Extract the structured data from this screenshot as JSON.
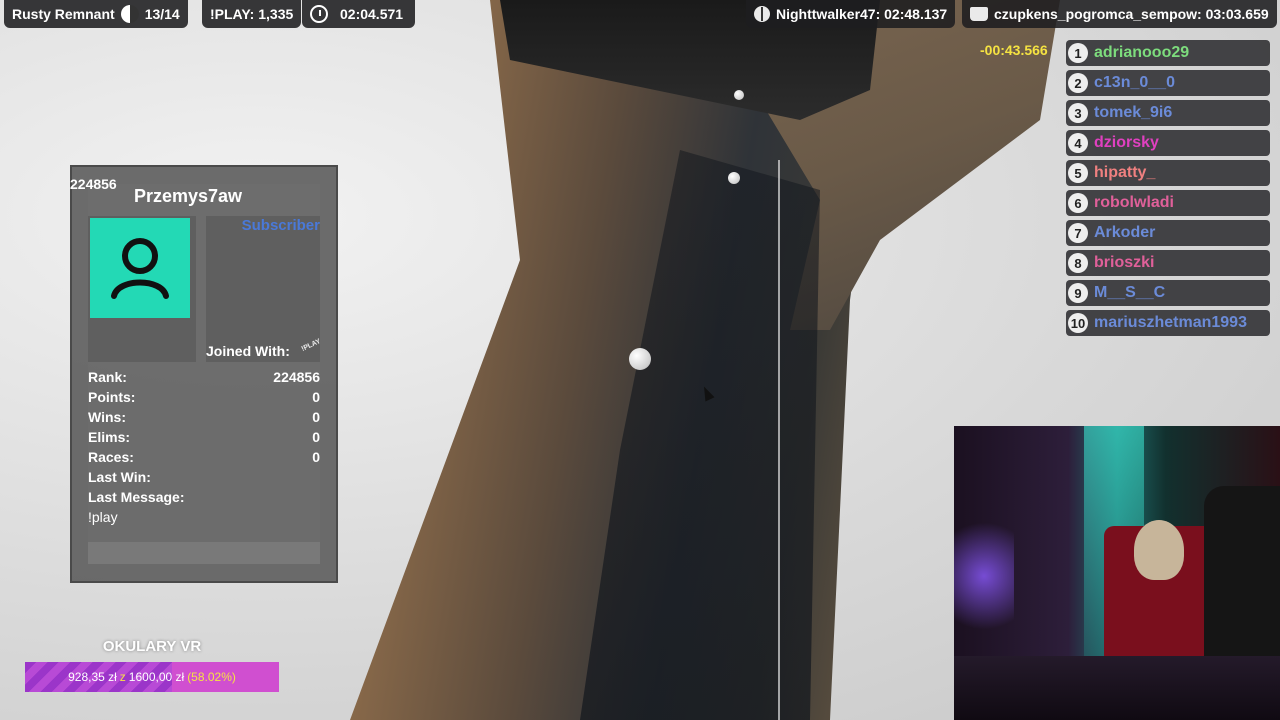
{
  "hud": {
    "map_name": "Rusty Remnant",
    "progress": "13/14",
    "play_count": "!PLAY: 1,335",
    "timer": "02:04.571",
    "record_1": "Nighttwalker47: 02:48.137",
    "record_2": "czupkens_pogromca_sempow: 03:03.659"
  },
  "leaderboard": {
    "delta": "-00:43.566",
    "entries": [
      {
        "rank": "1",
        "name": "adrianooo29",
        "color": "#7ddc7d"
      },
      {
        "rank": "2",
        "name": "c13n_0__0",
        "color": "#6b8bd8"
      },
      {
        "rank": "3",
        "name": "tomek_9i6",
        "color": "#6b8bd8"
      },
      {
        "rank": "4",
        "name": "dziorsky",
        "color": "#e040c0"
      },
      {
        "rank": "5",
        "name": "hipatty_",
        "color": "#f08080"
      },
      {
        "rank": "6",
        "name": "robolwladi",
        "color": "#e0609a"
      },
      {
        "rank": "7",
        "name": "Arkoder",
        "color": "#6b8bd8"
      },
      {
        "rank": "8",
        "name": "brioszki",
        "color": "#e0609a"
      },
      {
        "rank": "9",
        "name": "M__S__C",
        "color": "#6b8bd8"
      },
      {
        "rank": "10",
        "name": "mariuszhetman1993",
        "color": "#6b8bd8"
      }
    ]
  },
  "player_card": {
    "id": "224856",
    "name": "Przemys7aw",
    "badge": "Subscriber",
    "joined_with": "Joined With:",
    "joined_badge": "!PLAY",
    "stats": [
      {
        "label": "Rank:",
        "value": "224856"
      },
      {
        "label": "Points:",
        "value": "0"
      },
      {
        "label": "Wins:",
        "value": "0"
      },
      {
        "label": "Elims:",
        "value": "0"
      },
      {
        "label": "Races:",
        "value": "0"
      },
      {
        "label": "Last Win:",
        "value": ""
      },
      {
        "label": "Last Message:",
        "value": ""
      }
    ],
    "last_message": "!play",
    "avatar_color": "#23d9b5"
  },
  "goal": {
    "title": "OKULARY VR",
    "current": "928,35 zł",
    "separator": "z",
    "target": "1600,00 zł",
    "percent_text": "(58.02%)",
    "fraction": 0.5802
  },
  "icons": {
    "progress": "half-circle-icon",
    "timer": "clock-icon",
    "record_1": "globe-icon",
    "record_2": "cap-icon"
  }
}
